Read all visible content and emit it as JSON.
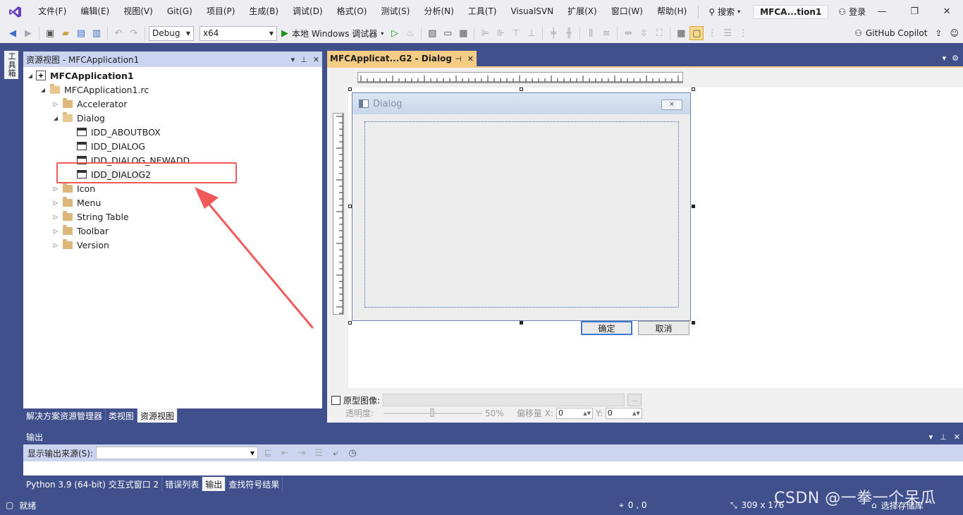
{
  "menubar": {
    "items": [
      "文件(F)",
      "编辑(E)",
      "视图(V)",
      "Git(G)",
      "项目(P)",
      "生成(B)",
      "调试(D)",
      "格式(O)",
      "测试(S)",
      "分析(N)",
      "工具(T)",
      "VisualSVN",
      "扩展(X)",
      "窗口(W)",
      "帮助(H)"
    ],
    "search": "搜索",
    "solution_title": "MFCA...tion1",
    "login": "登录"
  },
  "toolbar": {
    "config": "Debug",
    "platform": "x64",
    "run_label": "本地 Windows 调试器",
    "copilot": "GitHub Copilot"
  },
  "left_rail": {
    "toolbox_tab": "工具箱"
  },
  "resource_view": {
    "title": "资源视图 - MFCApplication1",
    "tree": {
      "project": "MFCApplication1",
      "rc_file": "MFCApplication1.rc",
      "accelerator": "Accelerator",
      "dialog": "Dialog",
      "dialogs": [
        "IDD_ABOUTBOX",
        "IDD_DIALOG",
        "IDD_DIALOG_NEWADD",
        "IDD_DIALOG2"
      ],
      "icon": "Icon",
      "menu": "Menu",
      "string_table": "String Table",
      "toolbar": "Toolbar",
      "version": "Version"
    },
    "tabs": [
      "解决方案资源管理器",
      "类视图",
      "资源视图"
    ],
    "active_tab": "资源视图"
  },
  "editor": {
    "tab_title": "MFCApplicat...G2 - Dialog",
    "dialog_preview": {
      "title": "Dialog",
      "ok_label": "确定",
      "cancel_label": "取消"
    },
    "prototype": {
      "checkbox_label": "原型图像:",
      "opacity_label": "透明度:",
      "opacity_value": "50%",
      "offset_label": "偏移量",
      "x_label": "X:",
      "x_value": "0",
      "y_label": "Y:",
      "y_value": "0"
    }
  },
  "output": {
    "title": "输出",
    "source_label": "显示输出来源(S):",
    "tabs": [
      "Python 3.9 (64-bit) 交互式窗口 2",
      "错误列表",
      "输出",
      "查找符号结果"
    ],
    "active_tab": "输出"
  },
  "status": {
    "ready": "就绪",
    "position": "0 , 0",
    "size": "309 x 176",
    "repo": "选择存储库"
  },
  "watermark": "CSDN @一拳一个呆瓜",
  "colors": {
    "accent": "#40508d",
    "doc_tab": "#f5cc84",
    "panel_header": "#ccd5f0",
    "annotation_red": "#f25a5a",
    "vs_purple": "#6c3fbf"
  }
}
